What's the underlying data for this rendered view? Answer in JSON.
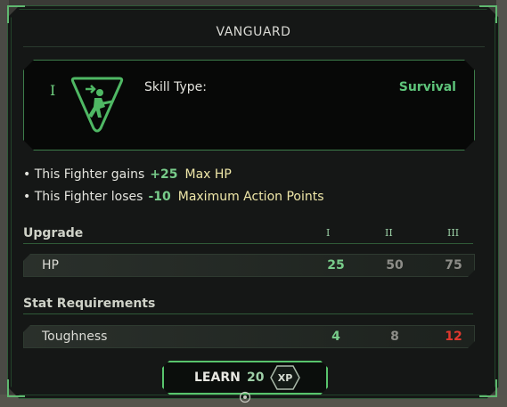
{
  "panel": {
    "title": "VANGUARD"
  },
  "skill": {
    "tier": "I",
    "icon": "running-soldier-icon",
    "type_label": "Skill Type:",
    "type_value": "Survival"
  },
  "effects": [
    {
      "bullet": "•",
      "text": "This Fighter gains",
      "value": "+25",
      "stat": "Max HP"
    },
    {
      "bullet": "•",
      "text": "This Fighter loses",
      "value": "-10",
      "stat": "Maximum Action Points"
    }
  ],
  "upgrade": {
    "heading": "Upgrade",
    "tiers": [
      "I",
      "II",
      "III"
    ],
    "rows": [
      {
        "name": "HP",
        "values": [
          "25",
          "50",
          "75"
        ]
      }
    ]
  },
  "requirements": {
    "heading": "Stat Requirements",
    "rows": [
      {
        "name": "Toughness",
        "values": [
          "4",
          "8",
          "12"
        ]
      }
    ]
  },
  "learn": {
    "label": "LEARN",
    "cost": "20",
    "currency": "XP"
  },
  "colors": {
    "accent": "#58c46c",
    "active_value": "#78cc8a",
    "inactive_value": "#8d8d88",
    "unmet_value": "#e0382e",
    "stat_highlight": "#efe7a8"
  }
}
